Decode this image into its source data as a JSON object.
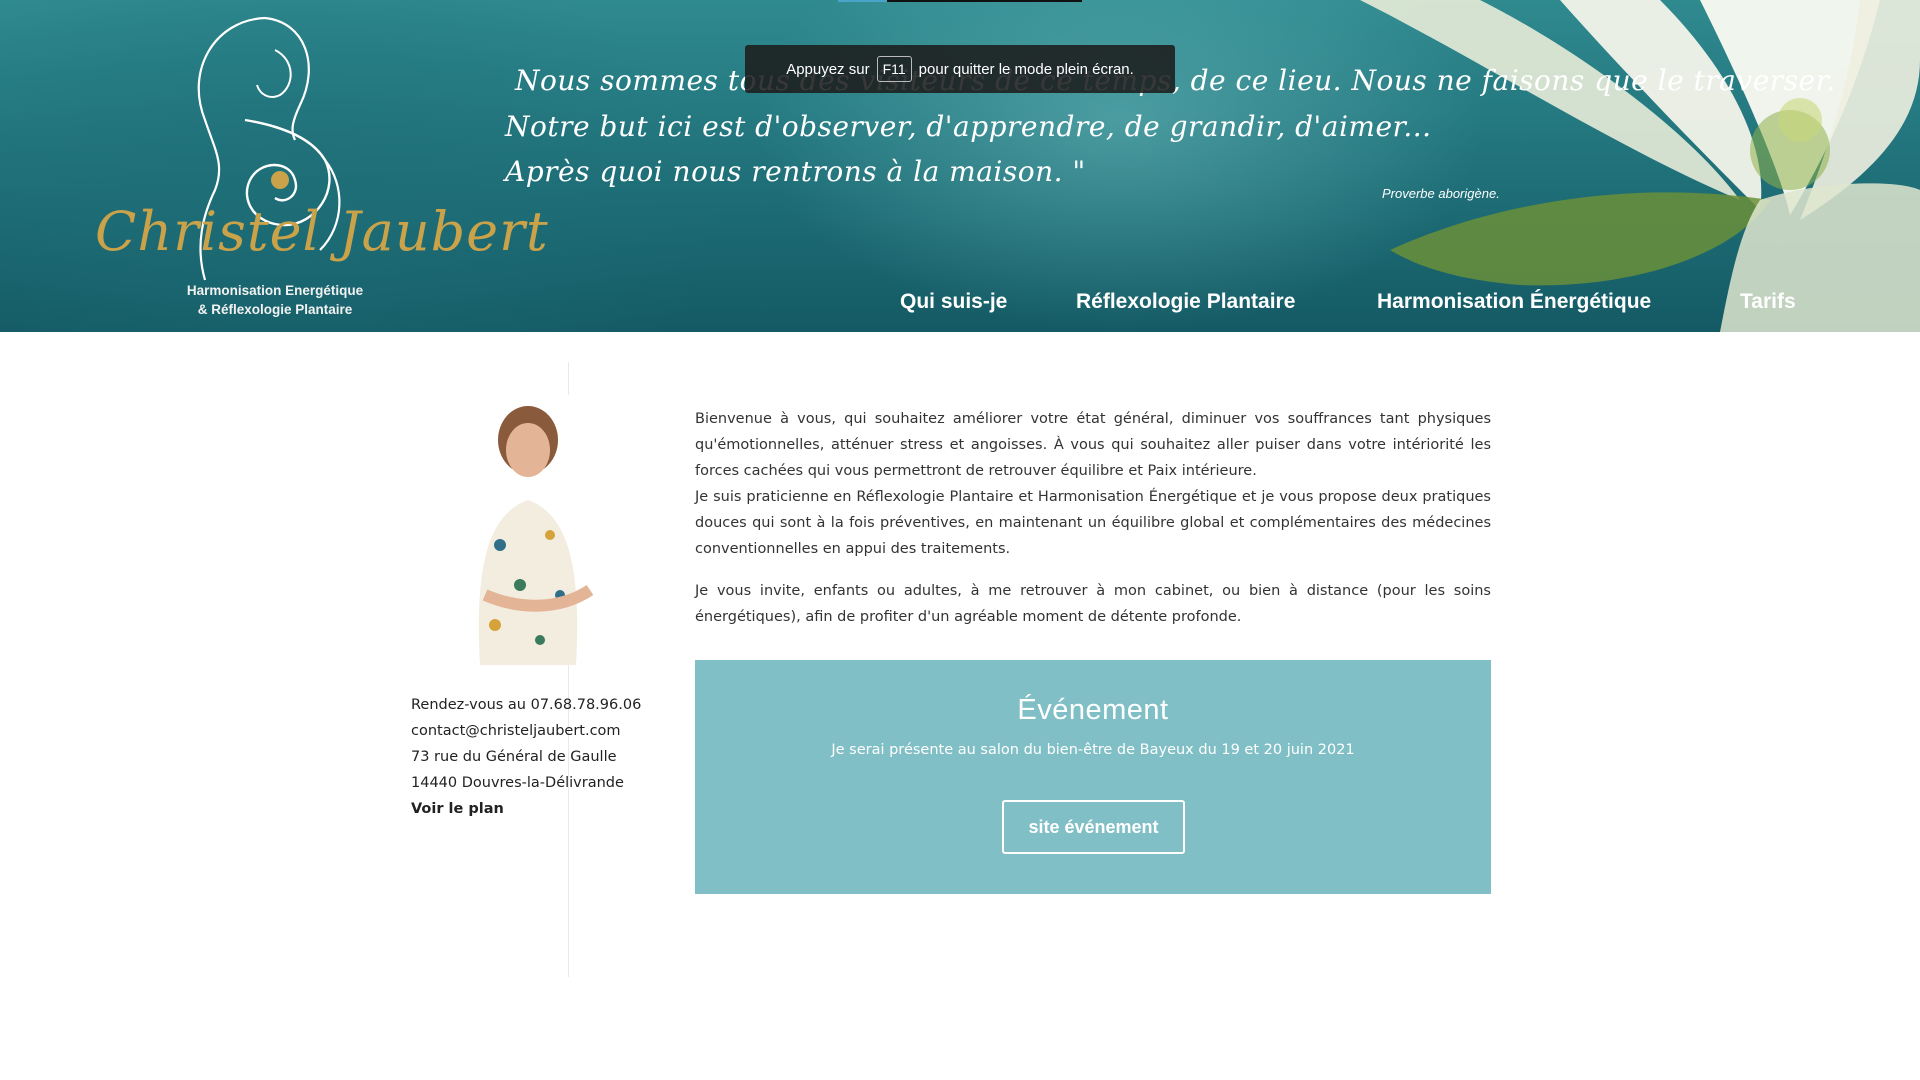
{
  "header": {
    "logo": {
      "name": "Christel Jaubert",
      "subtitle_line1": "Harmonisation Energétique",
      "subtitle_line2": "& Réflexologie Plantaire",
      "icon": "pregnant-woman-spiral-icon",
      "name_color": "#c9a24a"
    },
    "quote": {
      "line1": "Nous sommes tous des visiteurs de ce temps, de ce lieu. Nous ne faisons que le traverser.",
      "line2": "Notre but ici est d'observer, d'apprendre, de grandir, d'aimer...",
      "line3": "Après quoi nous rentrons à la maison. \"",
      "source": "Proverbe aborigène."
    },
    "fullscreen_notice": {
      "before": "Appuyez sur",
      "key": "F11",
      "after": "pour quitter le mode plein écran."
    },
    "nav": {
      "items": [
        {
          "label": "Qui suis-je"
        },
        {
          "label": "Réflexologie Plantaire"
        },
        {
          "label": "Harmonisation Énergétique"
        },
        {
          "label": "Tarifs"
        }
      ]
    },
    "banner_color": "#1f6f78"
  },
  "sidebar": {
    "portrait_icon": "portrait-photo",
    "contact": {
      "phone": "Rendez-vous au 07.68.78.96.06",
      "email": "contact@christeljaubert.com",
      "street": "73 rue du Général de Gaulle",
      "city": "14440 Douvres-la-Délivrande",
      "map_link": "Voir le plan"
    }
  },
  "main": {
    "intro": {
      "p1": "Bienvenue à vous, qui souhaitez améliorer votre état général, diminuer vos souffrances tant physiques qu'émotionnelles, atténuer stress et angoisses. À vous qui souhaitez aller puiser dans votre intériorité les forces cachées qui vous permettront de retrouver équilibre et Paix intérieure.",
      "p2": "Je suis praticienne en Réflexologie Plantaire et Harmonisation Énergétique et je vous propose deux pratiques douces qui sont à la fois préventives, en maintenant un équilibre global et complémentaires des médecines conventionnelles en appui des traitements.",
      "p3": "Je vous invite, enfants ou adultes, à me retrouver à mon cabinet, ou bien à distance (pour les soins énergétiques), afin de profiter d'un agréable moment de détente profonde."
    },
    "event": {
      "title": "Événement",
      "text": "Je serai présente au salon du bien-être de Bayeux du 19 et 20 juin 2021",
      "button": "site événement",
      "background": "#80bfc5"
    }
  }
}
